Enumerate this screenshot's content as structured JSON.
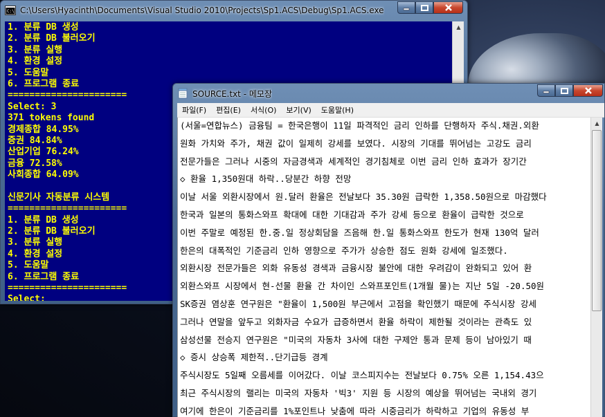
{
  "console": {
    "title": "C:\\Users\\Hyacinth\\Documents\\Visual Studio 2010\\Projects\\Sp1.ACS\\Debug\\Sp1.ACS.exe",
    "lines": [
      "1. 분류 DB 생성",
      "2. 분류 DB 불러오기",
      "3. 분류 실행",
      "4. 환경 설정",
      "5. 도움말",
      "6. 프로그램 종료",
      "======================",
      "Select: 3",
      "371 tokens found",
      "경제종합 84.95%",
      "증권 84.84%",
      "산업기업 76.24%",
      "금융 72.58%",
      "사회종합 64.09%",
      "",
      "신문기사 자동분류 시스템",
      "======================",
      "1. 분류 DB 생성",
      "2. 분류 DB 불러오기",
      "3. 분류 실행",
      "4. 환경 설정",
      "5. 도움말",
      "6. 프로그램 종료",
      "======================",
      "Select:"
    ]
  },
  "notepad": {
    "title": "SOURCE.txt - 메모장",
    "menu": [
      "파일(F)",
      "편집(E)",
      "서식(O)",
      "보기(V)",
      "도움말(H)"
    ],
    "lines": [
      "(서울=연합뉴스) 금융팀 = 한국은행이 11일 파격적인 금리 인하를 단행하자 주식.채권.외환",
      "원화 가치와 주가, 채권 값이 일제히 강세를 보였다. 시장의 기대를 뛰어넘는 고강도 금리",
      "전문가들은 그러나 시중의 자금경색과 세계적인 경기침체로 이번 금리 인하 효과가 장기간",
      "◇ 환율 1,350원대 하락..당분간 하향 전망",
      "이날 서울 외환시장에서 원.달러 환율은 전날보다 35.30원 급락한 1,358.50원으로 마감했다",
      "한국과 일본의 통화스와프 확대에 대한 기대감과 주가 강세 등으로 환율이 급락한 것으로",
      "이번 주말로 예정된 한.중.일 정상회담을 즈음해 한.일 통화스와프 한도가 현재 130억 달러",
      "한은의 대폭적인 기준금리 인하 영향으로 주가가 상승한 점도 원화 강세에 일조했다.",
      "외환시장 전문가들은 외화 유동성 경색과 금융시장 불안에 대한 우려감이 완화되고 있어 환",
      "외환스와프 시장에서 현-선물 환율 간 차이인 스와프포인트(1개월 물)는 지난 5일 -20.50원",
      "SK증권 염상훈 연구원은 \"환율이 1,500원 부근에서 고점을 확인했기 때문에 주식시장 강세",
      "그러나 연말을 앞두고 외화자금 수요가 급증하면서 환율 하락이 제한될 것이라는 관측도 있",
      "삼성선물 전승지 연구원은 \"미국의 자동차 3사에 대한 구제안 통과 문제 등이 남아있기 때",
      "◇ 증시 상승폭 제한적..단기급등 경계",
      "주식시장도 5일째 오름세를 이어갔다. 이날 코스피지수는 전날보다 0.75% 오른 1,154.43으",
      "최근 주식시장의 랠리는 미국의 자동차 '빅3' 지원 등 시장의 예상을 뛰어넘는 국내외 경기",
      "여기에 한은이 기준금리를 1%포인트나 낮춤에 따라 시중금리가 하락하고 기업의 유동성 부"
    ]
  },
  "colors": {
    "console_bg": "#000080",
    "console_text": "#ffff00",
    "titlebar": "#4c6c95",
    "close_button": "#c8472e"
  },
  "icons": {
    "console": "console-app-icon",
    "notepad": "notepad-icon"
  }
}
